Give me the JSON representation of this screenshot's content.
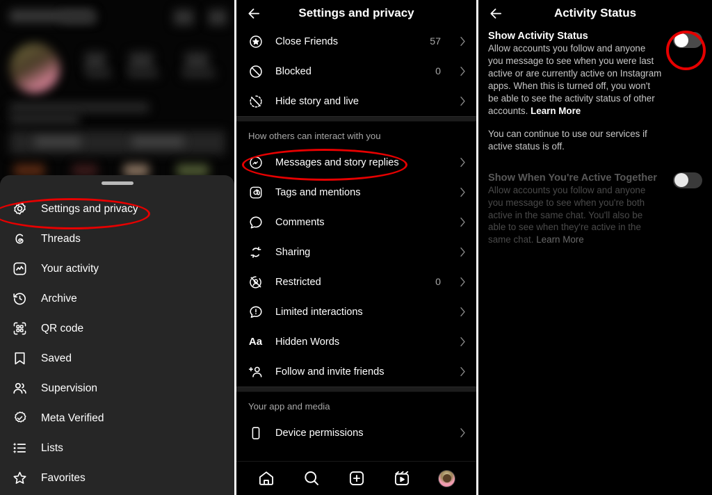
{
  "profile_panel": {
    "blurred_note": "blurred instagram profile header",
    "sheet": {
      "items": [
        {
          "label": "Settings and privacy",
          "icon": "gear-icon",
          "highlighted": true
        },
        {
          "label": "Threads",
          "icon": "threads-icon",
          "highlighted": false
        },
        {
          "label": "Your activity",
          "icon": "activity-chart-icon",
          "highlighted": false
        },
        {
          "label": "Archive",
          "icon": "archive-clock-icon",
          "highlighted": false
        },
        {
          "label": "QR code",
          "icon": "qr-code-icon",
          "highlighted": false
        },
        {
          "label": "Saved",
          "icon": "bookmark-icon",
          "highlighted": false
        },
        {
          "label": "Supervision",
          "icon": "people-icon",
          "highlighted": false
        },
        {
          "label": "Meta Verified",
          "icon": "verified-badge-icon",
          "highlighted": false
        },
        {
          "label": "Lists",
          "icon": "list-icon",
          "highlighted": false
        },
        {
          "label": "Favorites",
          "icon": "star-icon",
          "highlighted": false
        }
      ]
    }
  },
  "settings_panel": {
    "header": {
      "title": "Settings and privacy",
      "back_icon": "back-arrow-icon"
    },
    "groups": [
      {
        "section_label": "",
        "items": [
          {
            "label": "Close Friends",
            "icon": "close-friends-star-icon",
            "count": "57",
            "chevron": true
          },
          {
            "label": "Blocked",
            "icon": "blocked-icon",
            "count": "0",
            "chevron": true
          },
          {
            "label": "Hide story and live",
            "icon": "hide-story-icon",
            "count": "",
            "chevron": true
          }
        ]
      },
      {
        "section_label": "How others can interact with you",
        "items": [
          {
            "label": "Messages and story replies",
            "icon": "messenger-icon",
            "count": "",
            "chevron": true,
            "highlighted": true
          },
          {
            "label": "Tags and mentions",
            "icon": "at-mention-icon",
            "count": "",
            "chevron": true
          },
          {
            "label": "Comments",
            "icon": "comment-bubble-icon",
            "count": "",
            "chevron": true
          },
          {
            "label": "Sharing",
            "icon": "sharing-repeat-icon",
            "count": "",
            "chevron": true
          },
          {
            "label": "Restricted",
            "icon": "restricted-icon",
            "count": "0",
            "chevron": true
          },
          {
            "label": "Limited interactions",
            "icon": "limited-interactions-icon",
            "count": "",
            "chevron": true
          },
          {
            "label": "Hidden Words",
            "icon": "hidden-words-aa-icon",
            "count": "",
            "chevron": true
          },
          {
            "label": "Follow and invite friends",
            "icon": "add-person-icon",
            "count": "",
            "chevron": true
          }
        ]
      },
      {
        "section_label": "Your app and media",
        "items": [
          {
            "label": "Device permissions",
            "icon": "device-phone-icon",
            "count": "",
            "chevron": true
          }
        ]
      }
    ],
    "tabbar": [
      {
        "icon": "home-icon",
        "name": "tab-home"
      },
      {
        "icon": "search-icon",
        "name": "tab-search"
      },
      {
        "icon": "add-post-icon",
        "name": "tab-create"
      },
      {
        "icon": "reels-icon",
        "name": "tab-reels"
      },
      {
        "icon": "profile-avatar-icon",
        "name": "tab-profile"
      }
    ]
  },
  "activity_panel": {
    "header": {
      "title": "Activity Status",
      "back_icon": "back-arrow-icon"
    },
    "rows": [
      {
        "title": "Show Activity Status",
        "body": "Allow accounts you follow and anyone you message to see when you were last active or are currently active on Instagram apps. When this is turned off, you won't be able to see the activity status of other accounts.",
        "learn_more": "Learn More",
        "body2": "You can continue to use our services if active status is off.",
        "toggle_state": "off",
        "dimmed": false,
        "highlighted": true
      },
      {
        "title": "Show When You're Active Together",
        "body": "Allow accounts you follow and anyone you message to see when you're both active in the same chat. You'll also be able to see when they're active in the same chat.",
        "learn_more": "Learn More",
        "body2": "",
        "toggle_state": "off",
        "dimmed": true,
        "highlighted": false
      }
    ]
  },
  "annotations": {
    "marker_color": "#e60000",
    "marker_shape": "ellipse",
    "targets": [
      "Settings and privacy",
      "Messages and story replies",
      "Show Activity Status toggle"
    ]
  }
}
